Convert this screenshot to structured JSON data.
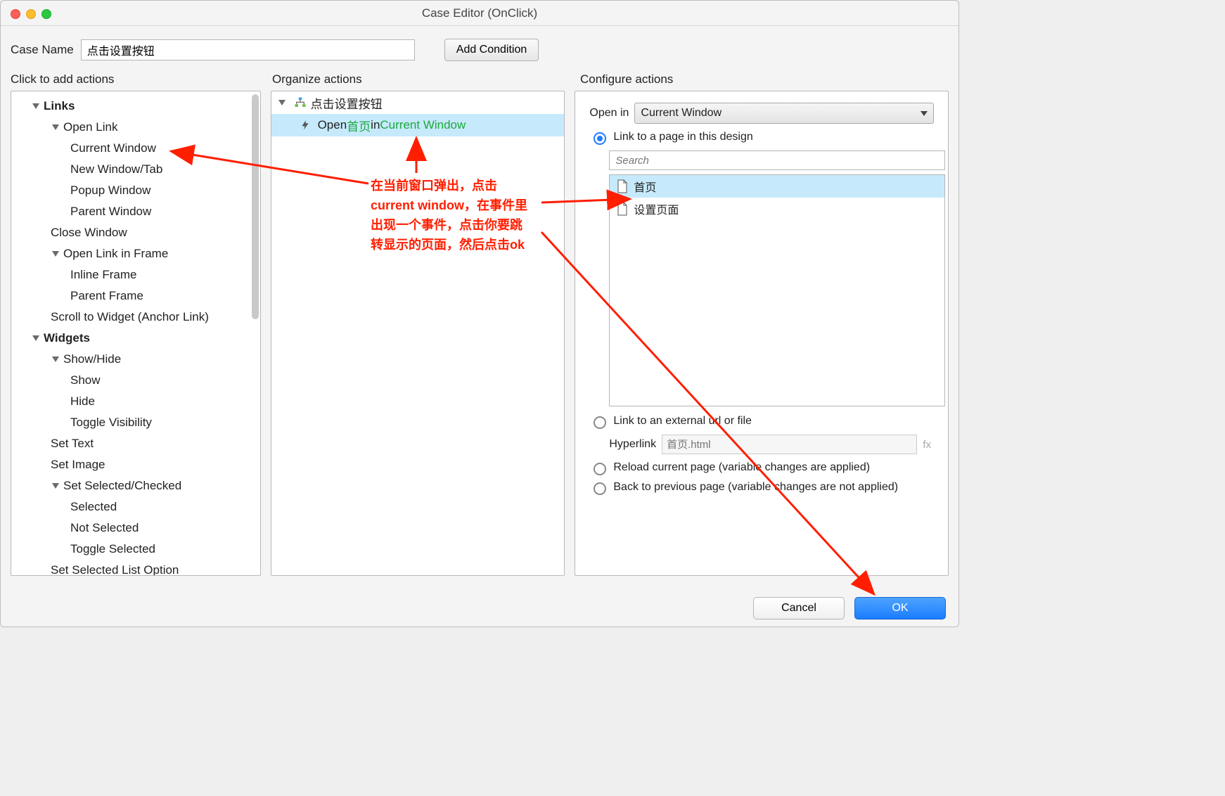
{
  "window": {
    "title": "Case Editor (OnClick)"
  },
  "case_name": {
    "label": "Case Name",
    "value": "点击设置按钮"
  },
  "buttons": {
    "add_condition": "Add Condition",
    "cancel": "Cancel",
    "ok": "OK"
  },
  "sections": {
    "actions": "Click to add actions",
    "organize": "Organize actions",
    "configure": "Configure actions"
  },
  "actions_tree": {
    "links": {
      "label": "Links",
      "open_link": {
        "label": "Open Link",
        "current_window": "Current Window",
        "new_window_tab": "New Window/Tab",
        "popup_window": "Popup Window",
        "parent_window": "Parent Window"
      },
      "close_window": "Close Window",
      "open_link_in_frame": {
        "label": "Open Link in Frame",
        "inline_frame": "Inline Frame",
        "parent_frame": "Parent Frame"
      },
      "scroll_to_widget": "Scroll to Widget (Anchor Link)"
    },
    "widgets": {
      "label": "Widgets",
      "show_hide": {
        "label": "Show/Hide",
        "show": "Show",
        "hide": "Hide",
        "toggle_visibility": "Toggle Visibility"
      },
      "set_text": "Set Text",
      "set_image": "Set Image",
      "set_selected_checked": {
        "label": "Set Selected/Checked",
        "selected": "Selected",
        "not_selected": "Not Selected",
        "toggle_selected": "Toggle Selected"
      },
      "set_selected_list_option": "Set Selected List Option"
    }
  },
  "organize_tree": {
    "case_label": "点击设置按钮",
    "action_open": "Open ",
    "action_page": "首页",
    "action_in": " in ",
    "action_target": "Current Window"
  },
  "configure": {
    "open_in_label": "Open in",
    "open_in_value": "Current Window",
    "link_design": "Link to a page in this design",
    "search_placeholder": "Search",
    "pages": {
      "home": "首页",
      "settings": "设置页面"
    },
    "link_external": "Link to an external url or file",
    "hyperlink_label": "Hyperlink",
    "hyperlink_value": "首页.html",
    "fx": "fx",
    "reload": "Reload current page (variable changes are applied)",
    "back": "Back to previous page (variable changes are not applied)"
  },
  "annotation": {
    "text": "在当前窗口弹出，点击\ncurrent window，在事件里\n出现一个事件，点击你要跳\n转显示的页面，然后点击ok"
  }
}
